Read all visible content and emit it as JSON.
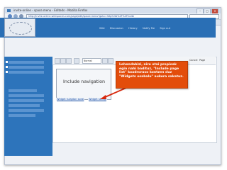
{
  "window": {
    "title": "invite-online - space.menu - Editeds - Mozilla Firefox",
    "minimize_label": "–",
    "maximize_label": "□",
    "close_label": "✕"
  },
  "browser": {
    "url": "http://invite-online.wikispaces.com/page/edit/space.menu?goto=http%3A%2F%2Finvite",
    "tab_label": "invite-online - space.menu - Editeds"
  },
  "site": {
    "nav": [
      "Wiki",
      "Discussion",
      "History",
      "Notify Me",
      "Sign out"
    ]
  },
  "editor": {
    "format_select": "Normal",
    "cancel_label": "Cancel",
    "page_label": "Page",
    "widget_label": "Include navigation",
    "widget_links": [
      "Widget tulajdon sorai",
      "Widget sorlap"
    ]
  },
  "callout": {
    "text": "Lehendabizi, nire otai propioak egin nahi badituz, \"Include page list\" koadroraso kontzen duz \"Widgets osabalu\" aukera sakatuz.",
    "color": "#e34d0b"
  },
  "colors": {
    "banner": "#2a6fb5",
    "sidebar": "#2d74bb",
    "accent": "#e34d0b"
  }
}
